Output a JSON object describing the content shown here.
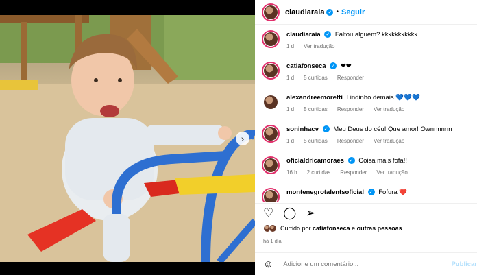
{
  "post": {
    "author": "claudiaraia",
    "follow_label": "Seguir",
    "separator": "•"
  },
  "comments": [
    {
      "user": "claudiaraia",
      "text": "Faltou alguém? kkkkkkkkkkk",
      "age": "1 d",
      "likes": "",
      "reply": "",
      "translate": "Ver tradução",
      "verified": true
    },
    {
      "user": "catiafonseca",
      "text": "❤︎❤︎",
      "age": "1 d",
      "likes": "5 curtidas",
      "reply": "Responder",
      "translate": "",
      "verified": true
    },
    {
      "user": "alexandreemoretti",
      "text": "Lindinho demais",
      "hearts": "💙💙💙",
      "age": "1 d",
      "likes": "5 curtidas",
      "reply": "Responder",
      "translate": "Ver tradução",
      "verified": false
    },
    {
      "user": "soninhacv",
      "text": "Meu Deus do céu! Que amor! Ownnnnnn",
      "age": "1 d",
      "likes": "5 curtidas",
      "reply": "Responder",
      "translate": "Ver tradução",
      "verified": true
    },
    {
      "user": "oficialdricamoraes",
      "text": "Coisa mais fofa!!",
      "age": "16 h",
      "likes": "2 curtidas",
      "reply": "Responder",
      "translate": "Ver tradução",
      "verified": true
    },
    {
      "user": "montenegrotalentsoficial",
      "text": "Fofura",
      "hearts": "❤️",
      "age": "",
      "likes": "",
      "reply": "",
      "translate": "",
      "verified": true
    }
  ],
  "likes": {
    "prefix": "Curtido por",
    "user": "catiafonseca",
    "joiner": "e",
    "others": "outras pessoas"
  },
  "timestamp": "há 1 dia",
  "add_comment": {
    "placeholder": "Adicione um comentário...",
    "publish": "Publicar"
  },
  "icons": {
    "like": "heart-outline-icon",
    "comment": "comment-bubble-icon",
    "share": "paper-plane-icon",
    "emoji": "smiley-icon",
    "next": "chevron-right-icon",
    "verified": "verified-badge-icon"
  },
  "colors": {
    "accent": "#0095f6",
    "story_ring": "#e1306c",
    "muted": "#737373"
  }
}
